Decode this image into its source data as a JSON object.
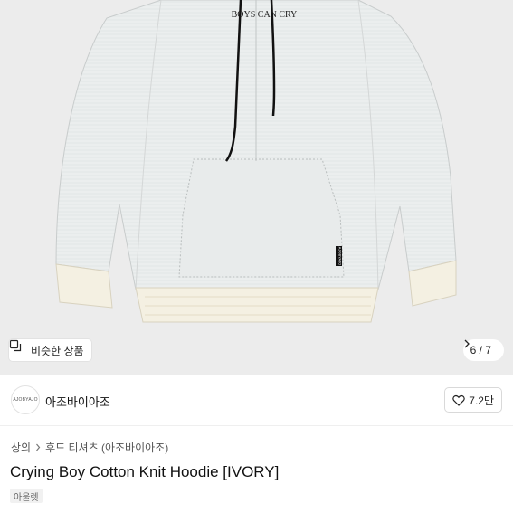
{
  "product_image": {
    "print_text": "BOYS CAN CRY",
    "tag_text": "AJOBYAJO",
    "background": "#ececec"
  },
  "similar_chip": {
    "icon": "similar-items-icon",
    "label": "비슷한 상품"
  },
  "image_counter": {
    "current": "6",
    "separator": "/",
    "total": "7",
    "icon": "chevron-right-icon"
  },
  "shop": {
    "logo_text": "AJOBYAJO",
    "name": "아조바이아조"
  },
  "like": {
    "icon": "heart-icon",
    "count": "7.2만"
  },
  "breadcrumb": {
    "category": "상의",
    "separator_icon": "chevron-right-icon",
    "subcategory": "후드 티셔츠 (아조바이아조)"
  },
  "product": {
    "title": "Crying Boy Cotton Knit Hoodie [IVORY]",
    "badge": "아울렛"
  }
}
